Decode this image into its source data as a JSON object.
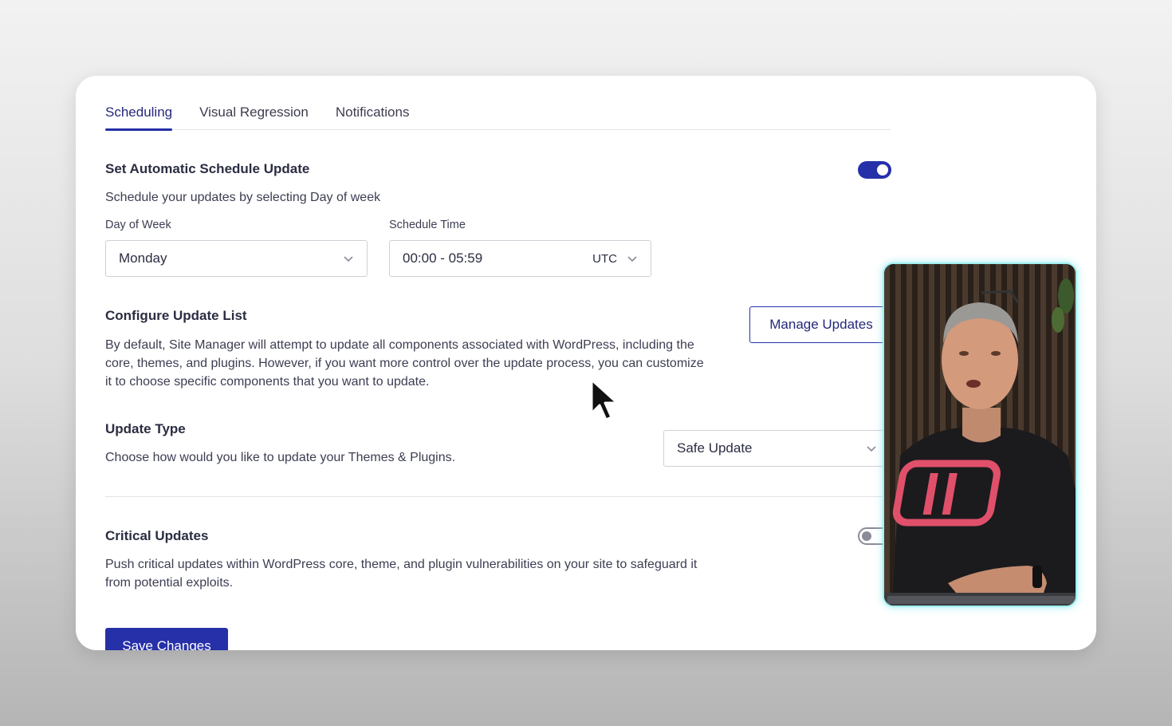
{
  "tabs": [
    {
      "label": "Scheduling",
      "active": true
    },
    {
      "label": "Visual Regression",
      "active": false
    },
    {
      "label": "Notifications",
      "active": false
    }
  ],
  "schedule": {
    "title": "Set Automatic Schedule Update",
    "description": "Schedule your updates by selecting Day of week",
    "enabled": true,
    "day_label": "Day of Week",
    "day_value": "Monday",
    "time_label": "Schedule Time",
    "time_value": "00:00 - 05:59",
    "timezone": "UTC"
  },
  "update_list": {
    "title": "Configure Update List",
    "description": "By default, Site Manager will attempt to update all components associated with WordPress, including the core, themes, and plugins. However, if you want more control over the update process, you can customize it to choose specific components that you want to update.",
    "button_label": "Manage Updates"
  },
  "update_type": {
    "title": "Update Type",
    "description": "Choose how would you like to update your Themes & Plugins.",
    "value": "Safe Update"
  },
  "critical": {
    "title": "Critical Updates",
    "description": "Push critical updates within WordPress core, theme, and plugin vulnerabilities on your site to safeguard it from potential exploits.",
    "enabled": false
  },
  "save_label": "Save Changes",
  "colors": {
    "accent": "#2630a8",
    "accent_text": "#24287a",
    "video_border": "#9feff0"
  },
  "icons": [
    "chevron-down-icon",
    "mouse-pointer-icon"
  ]
}
